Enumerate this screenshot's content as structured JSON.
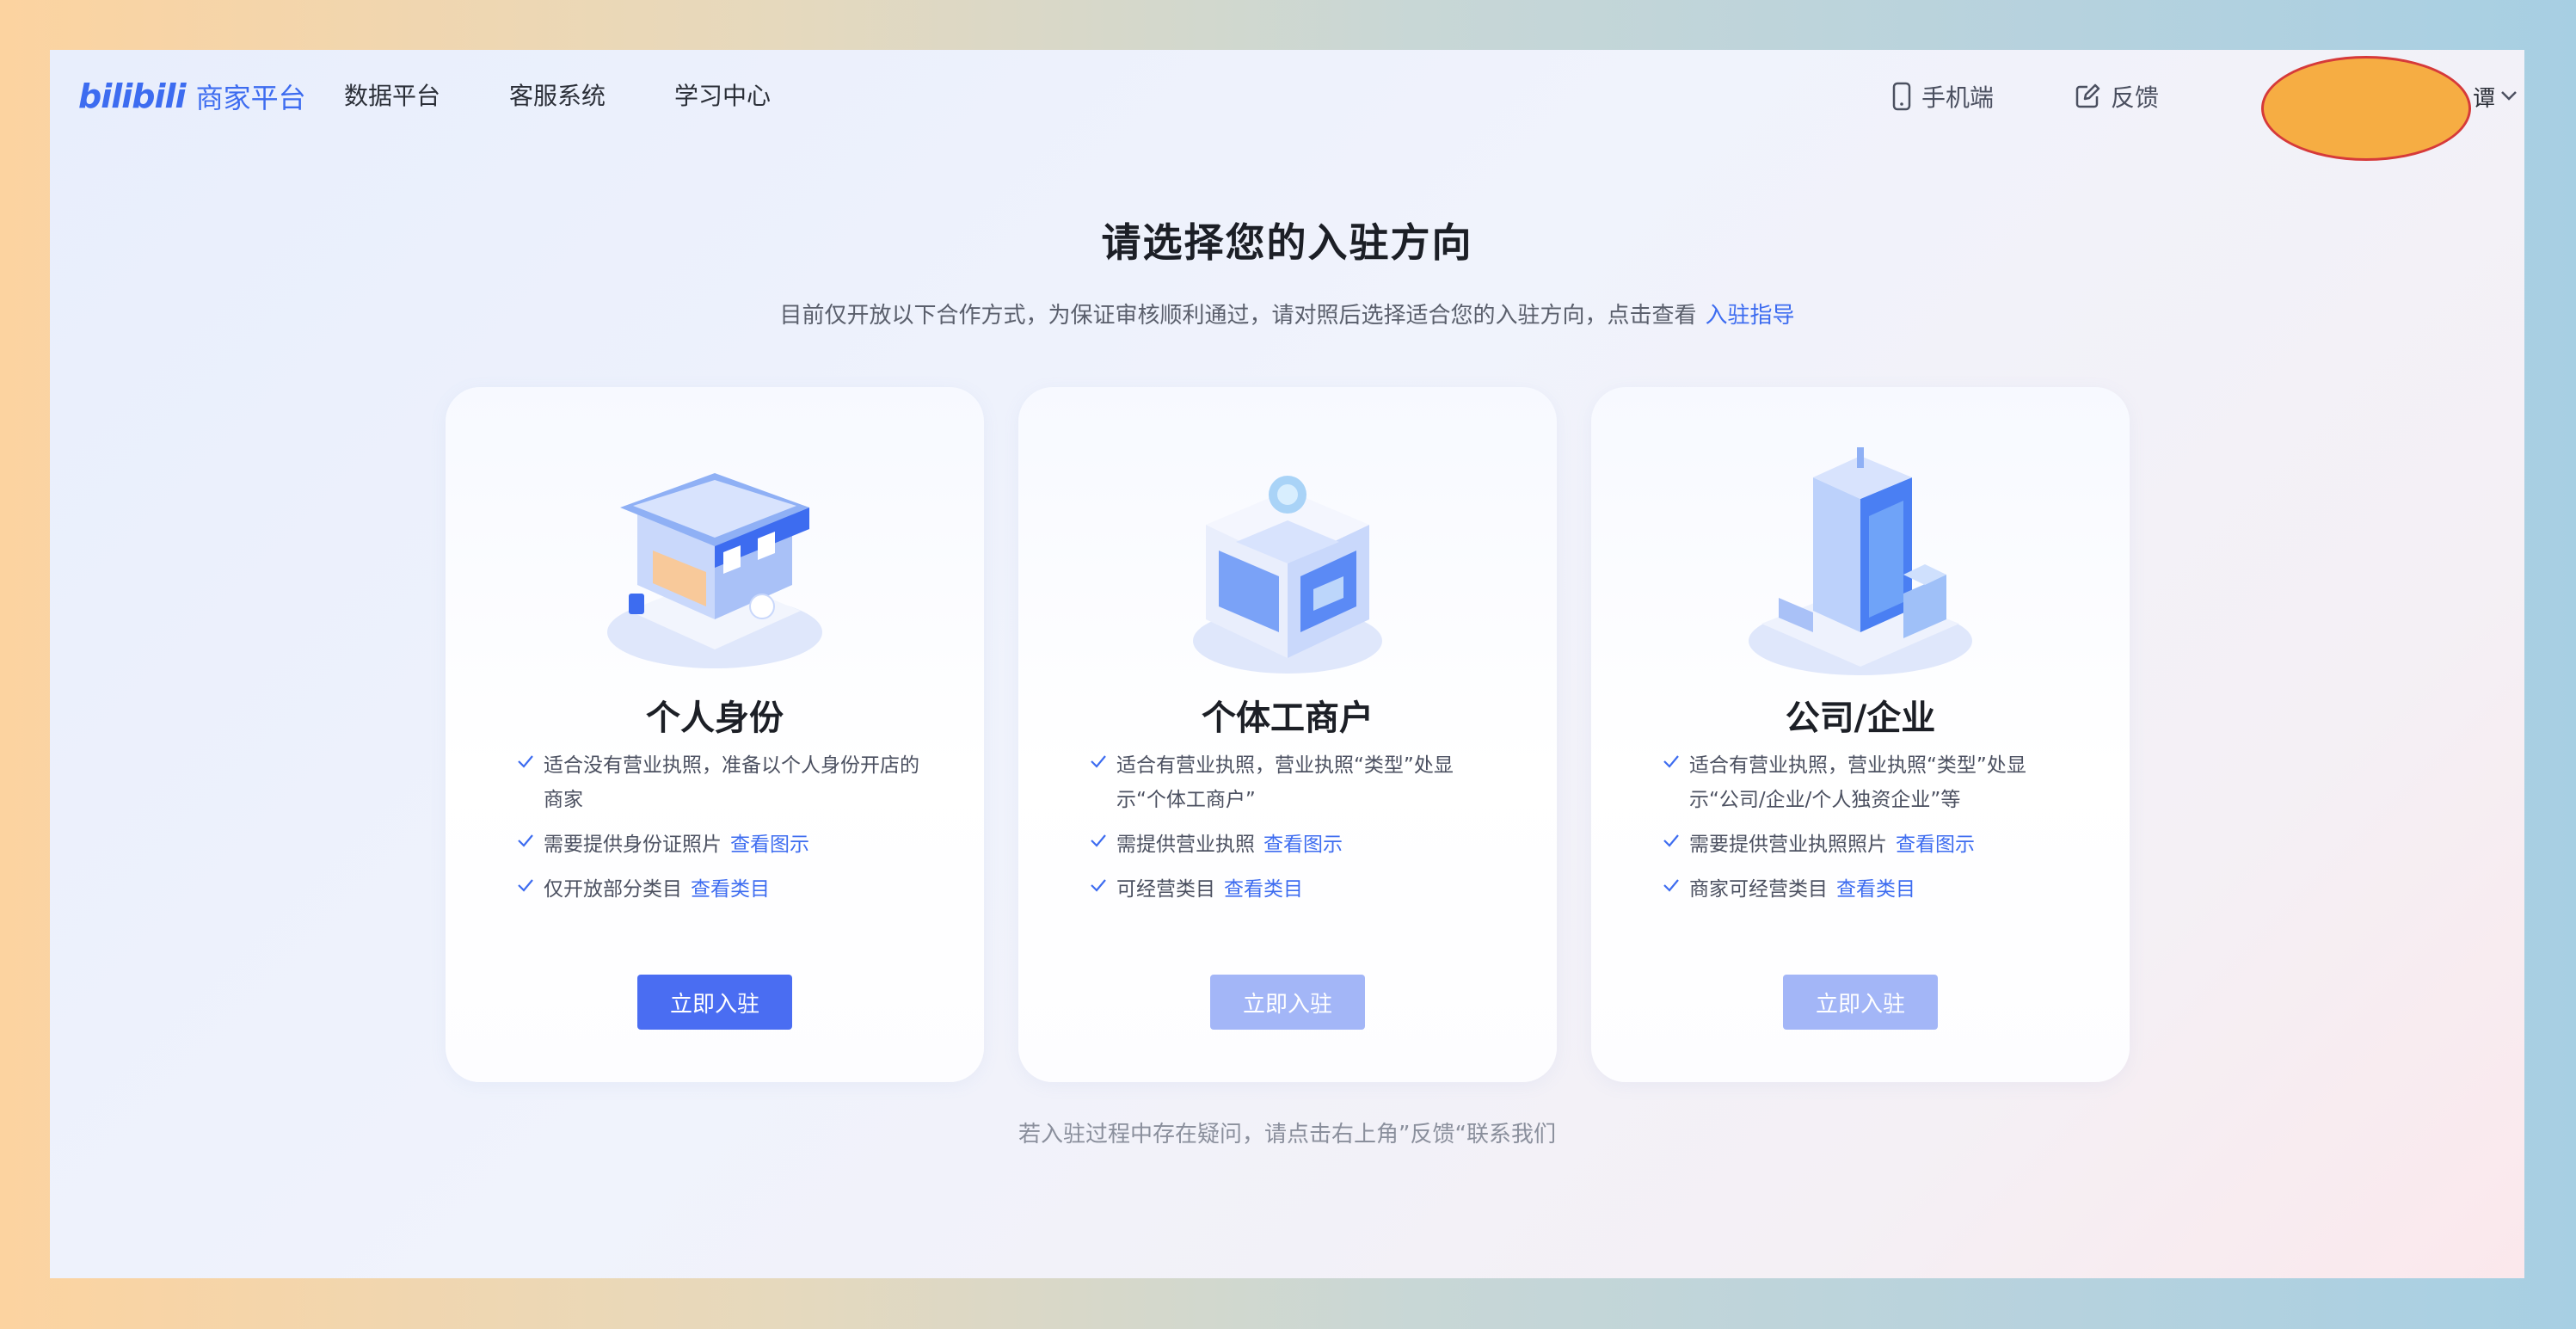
{
  "header": {
    "logo_mark": "bilibili",
    "logo_text": "商家平台",
    "nav": [
      "数据平台",
      "客服系统",
      "学习中心"
    ],
    "mobile_label": "手机端",
    "feedback_label": "反馈",
    "user_name_tail": "谭"
  },
  "main": {
    "title": "请选择您的入驻方向",
    "subtitle": "目前仅开放以下合作方式，为保证审核顺利通过，请对照后选择适合您的入驻方向，点击查看",
    "subtitle_link": "入驻指导",
    "footer_note": "若入驻过程中存在疑问，请点击右上角”反馈“联系我们"
  },
  "cards": [
    {
      "title": "个人身份",
      "features": [
        {
          "text": "适合没有营业执照，准备以个人身份开店的商家",
          "link": ""
        },
        {
          "text": "需要提供身份证照片",
          "link": "查看图示"
        },
        {
          "text": "仅开放部分类目",
          "link": "查看类目"
        }
      ],
      "button": "立即入驻"
    },
    {
      "title": "个体工商户",
      "features": [
        {
          "text": "适合有营业执照，营业执照“类型”处显示“个体工商户”",
          "link": ""
        },
        {
          "text": "需提供营业执照",
          "link": "查看图示"
        },
        {
          "text": "可经营类目",
          "link": "查看类目"
        }
      ],
      "button": "立即入驻"
    },
    {
      "title": "公司/企业",
      "features": [
        {
          "text": "适合有营业执照，营业执照“类型”处显示“公司/企业/个人独资企业”等",
          "link": ""
        },
        {
          "text": "需要提供营业执照照片",
          "link": "查看图示"
        },
        {
          "text": "商家可经营类目",
          "link": "查看类目"
        }
      ],
      "button": "立即入驻"
    }
  ],
  "colors": {
    "accent": "#3d6cf0",
    "button_primary": "#4a6df2",
    "button_disabled": "#a3b6f7",
    "redaction_fill": "#f6ad43"
  }
}
